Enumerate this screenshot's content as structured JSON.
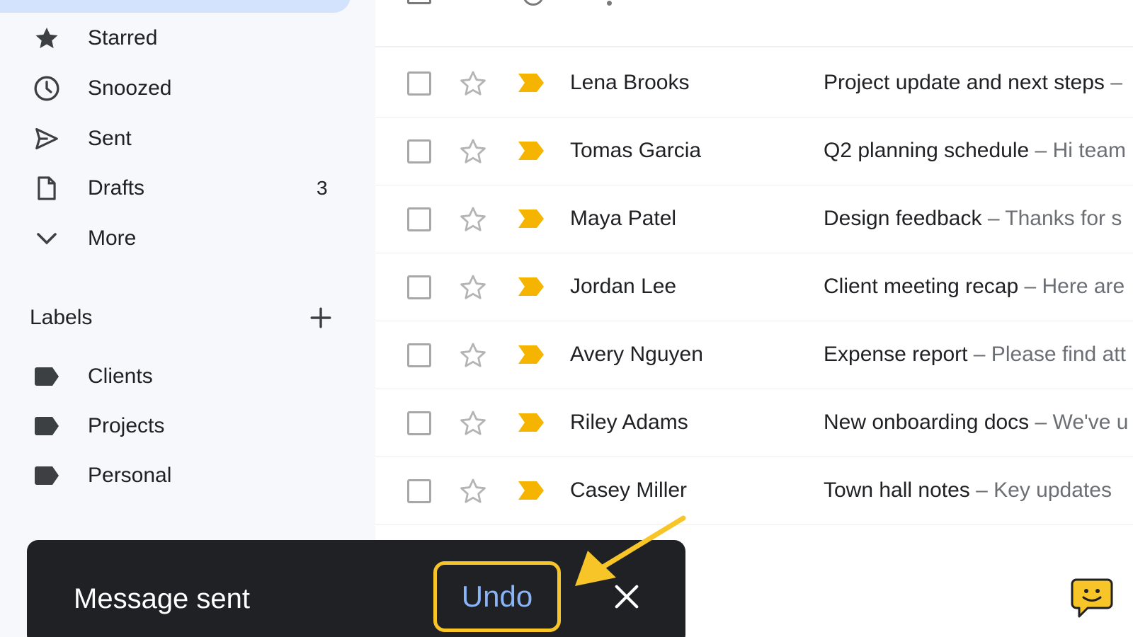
{
  "sidebar": {
    "items": [
      {
        "label": "Starred",
        "icon": "star-icon"
      },
      {
        "label": "Snoozed",
        "icon": "clock-icon"
      },
      {
        "label": "Sent",
        "icon": "send-icon"
      },
      {
        "label": "Drafts",
        "icon": "draft-icon",
        "count": "3"
      },
      {
        "label": "More",
        "icon": "chevron-down-icon"
      }
    ],
    "labels_header": "Labels",
    "labels": [
      {
        "label": "Clients"
      },
      {
        "label": "Projects"
      },
      {
        "label": "Personal"
      }
    ]
  },
  "emails": [
    {
      "sender": "Lena Brooks",
      "subject": "Project update and next steps",
      "snippet": " –"
    },
    {
      "sender": "Tomas Garcia",
      "subject": "Q2 planning schedule",
      "snippet": " – Hi team"
    },
    {
      "sender": "Maya Patel",
      "subject": "Design feedback",
      "snippet": " – Thanks for s"
    },
    {
      "sender": "Jordan Lee",
      "subject": "Client meeting recap",
      "snippet": " – Here are"
    },
    {
      "sender": "Avery Nguyen",
      "subject": "Expense report",
      "snippet": " – Please find att"
    },
    {
      "sender": "Riley Adams",
      "subject": "New onboarding docs",
      "snippet": " – We've u"
    },
    {
      "sender": "Casey Miller",
      "subject": "Town hall notes",
      "snippet": " – Key updates"
    }
  ],
  "snackbar": {
    "message": "Message sent",
    "undo_label": "Undo"
  },
  "colors": {
    "sidebar_bg": "#f6f8fc",
    "important_tag": "#f4b400",
    "snackbar_bg": "#202124",
    "undo_text": "#8ab4f8",
    "highlight": "#f7c528"
  }
}
